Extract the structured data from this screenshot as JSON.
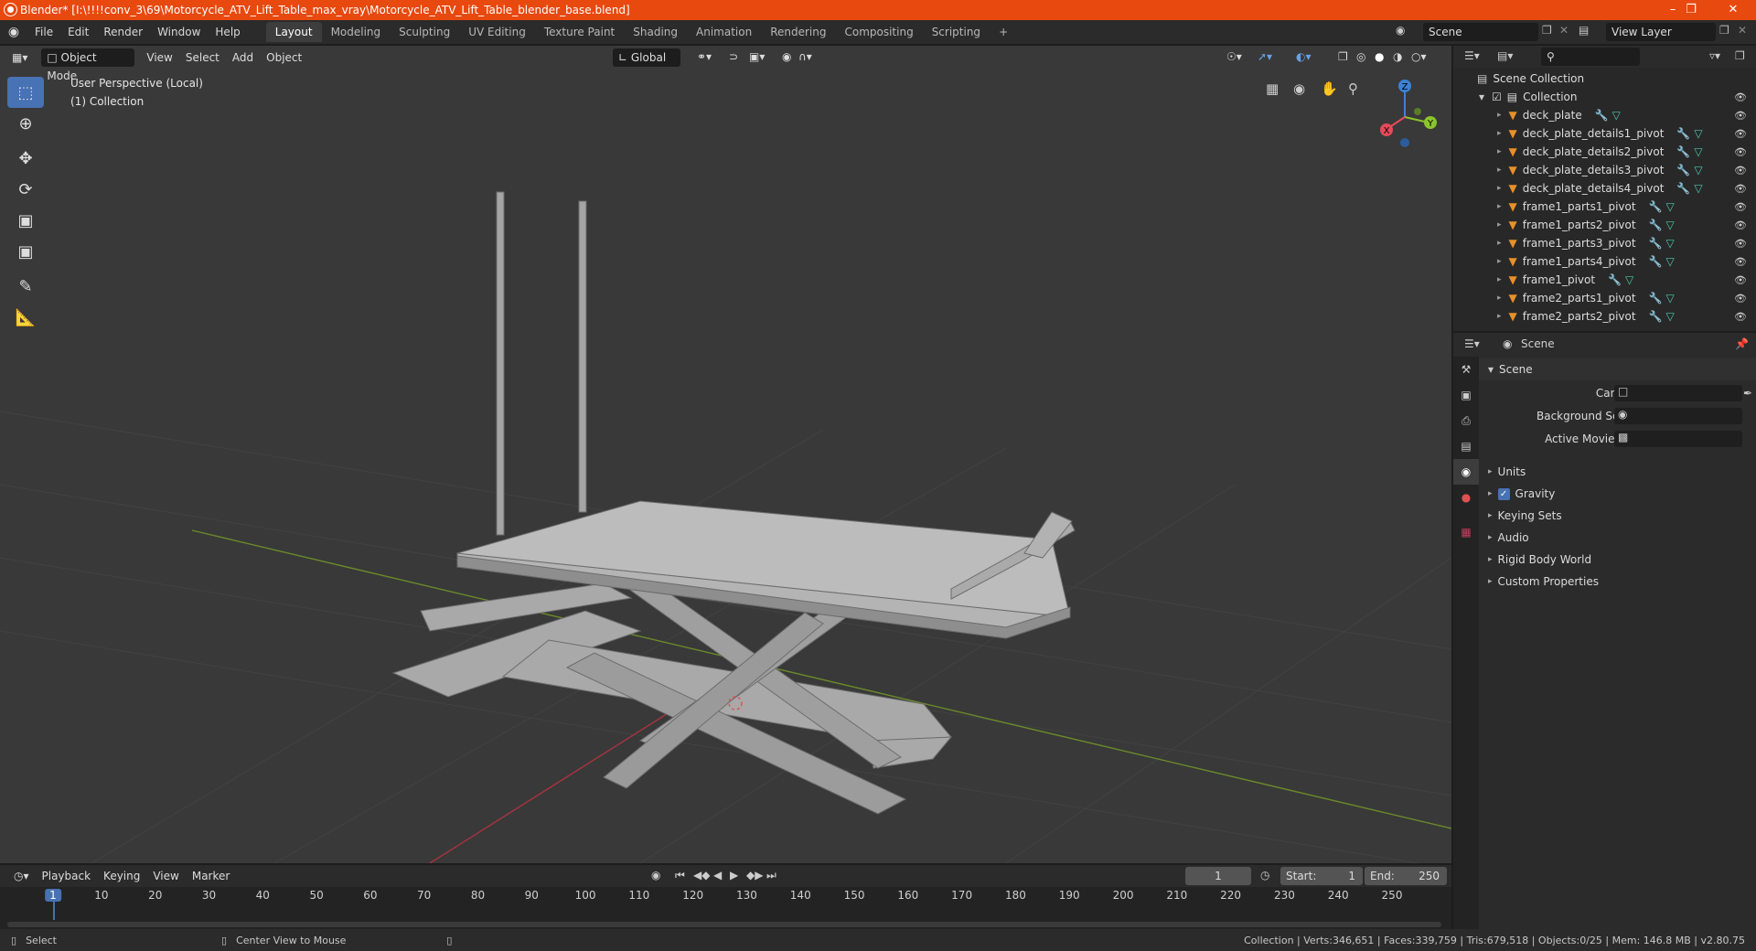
{
  "window": {
    "title": "Blender* [I:\\!!!!conv_3\\69\\Motorcycle_ATV_Lift_Table_max_vray\\Motorcycle_ATV_Lift_Table_blender_base.blend]",
    "minimize": "–",
    "maximize": "❐",
    "close": "✕"
  },
  "menu": [
    "File",
    "Edit",
    "Render",
    "Window",
    "Help"
  ],
  "workspaces": [
    "Layout",
    "Modeling",
    "Sculpting",
    "UV Editing",
    "Texture Paint",
    "Shading",
    "Animation",
    "Rendering",
    "Compositing",
    "Scripting"
  ],
  "active_workspace": "Layout",
  "scene_selector": "Scene",
  "view_layer_selector": "View Layer",
  "viewport": {
    "mode": "Object Mode",
    "menus": [
      "View",
      "Select",
      "Add",
      "Object"
    ],
    "transform_orientation": "Global",
    "perspective_label": "User Perspective (Local)",
    "collection_label": "(1) Collection",
    "gizmo": {
      "x": "X",
      "y": "Y",
      "z": "Z"
    }
  },
  "outliner": {
    "root": "Scene Collection",
    "collection": "Collection",
    "items": [
      "deck_plate",
      "deck_plate_details1_pivot",
      "deck_plate_details2_pivot",
      "deck_plate_details3_pivot",
      "deck_plate_details4_pivot",
      "frame1_parts1_pivot",
      "frame1_parts2_pivot",
      "frame1_parts3_pivot",
      "frame1_parts4_pivot",
      "frame1_pivot",
      "frame2_parts1_pivot",
      "frame2_parts2_pivot"
    ]
  },
  "properties": {
    "header": "Scene",
    "section": "Scene",
    "camera_label": "Camera",
    "background_scene_label": "Background Scene",
    "active_movie_clip_label": "Active Movie Clip",
    "panels": [
      "Units",
      "Gravity",
      "Keying Sets",
      "Audio",
      "Rigid Body World",
      "Custom Properties"
    ],
    "gravity_checked": true
  },
  "timeline": {
    "menus": [
      "Playback",
      "Keying",
      "View",
      "Marker"
    ],
    "current_frame": "1",
    "start_label": "Start:",
    "start": "1",
    "end_label": "End:",
    "end": "250",
    "ticks": [
      "1",
      "10",
      "20",
      "30",
      "40",
      "50",
      "60",
      "70",
      "80",
      "90",
      "100",
      "110",
      "120",
      "130",
      "140",
      "150",
      "160",
      "170",
      "180",
      "190",
      "200",
      "210",
      "220",
      "230",
      "240",
      "250"
    ]
  },
  "status": {
    "left": "Select",
    "middle": "Center View to Mouse",
    "right": "Collection | Verts:346,651 | Faces:339,759 | Tris:679,518 | Objects:0/25 | Mem: 146.8 MB | v2.80.75"
  },
  "colors": {
    "accent": "#4772b3",
    "titlebar": "#e8490f",
    "axis_x": "#e64a5a",
    "axis_y": "#8ac62a",
    "axis_z": "#3b82d6",
    "object_icon": "#e8902a",
    "modifier_icon": "#6aa0e6",
    "mesh_icon": "#4ec9a7"
  }
}
